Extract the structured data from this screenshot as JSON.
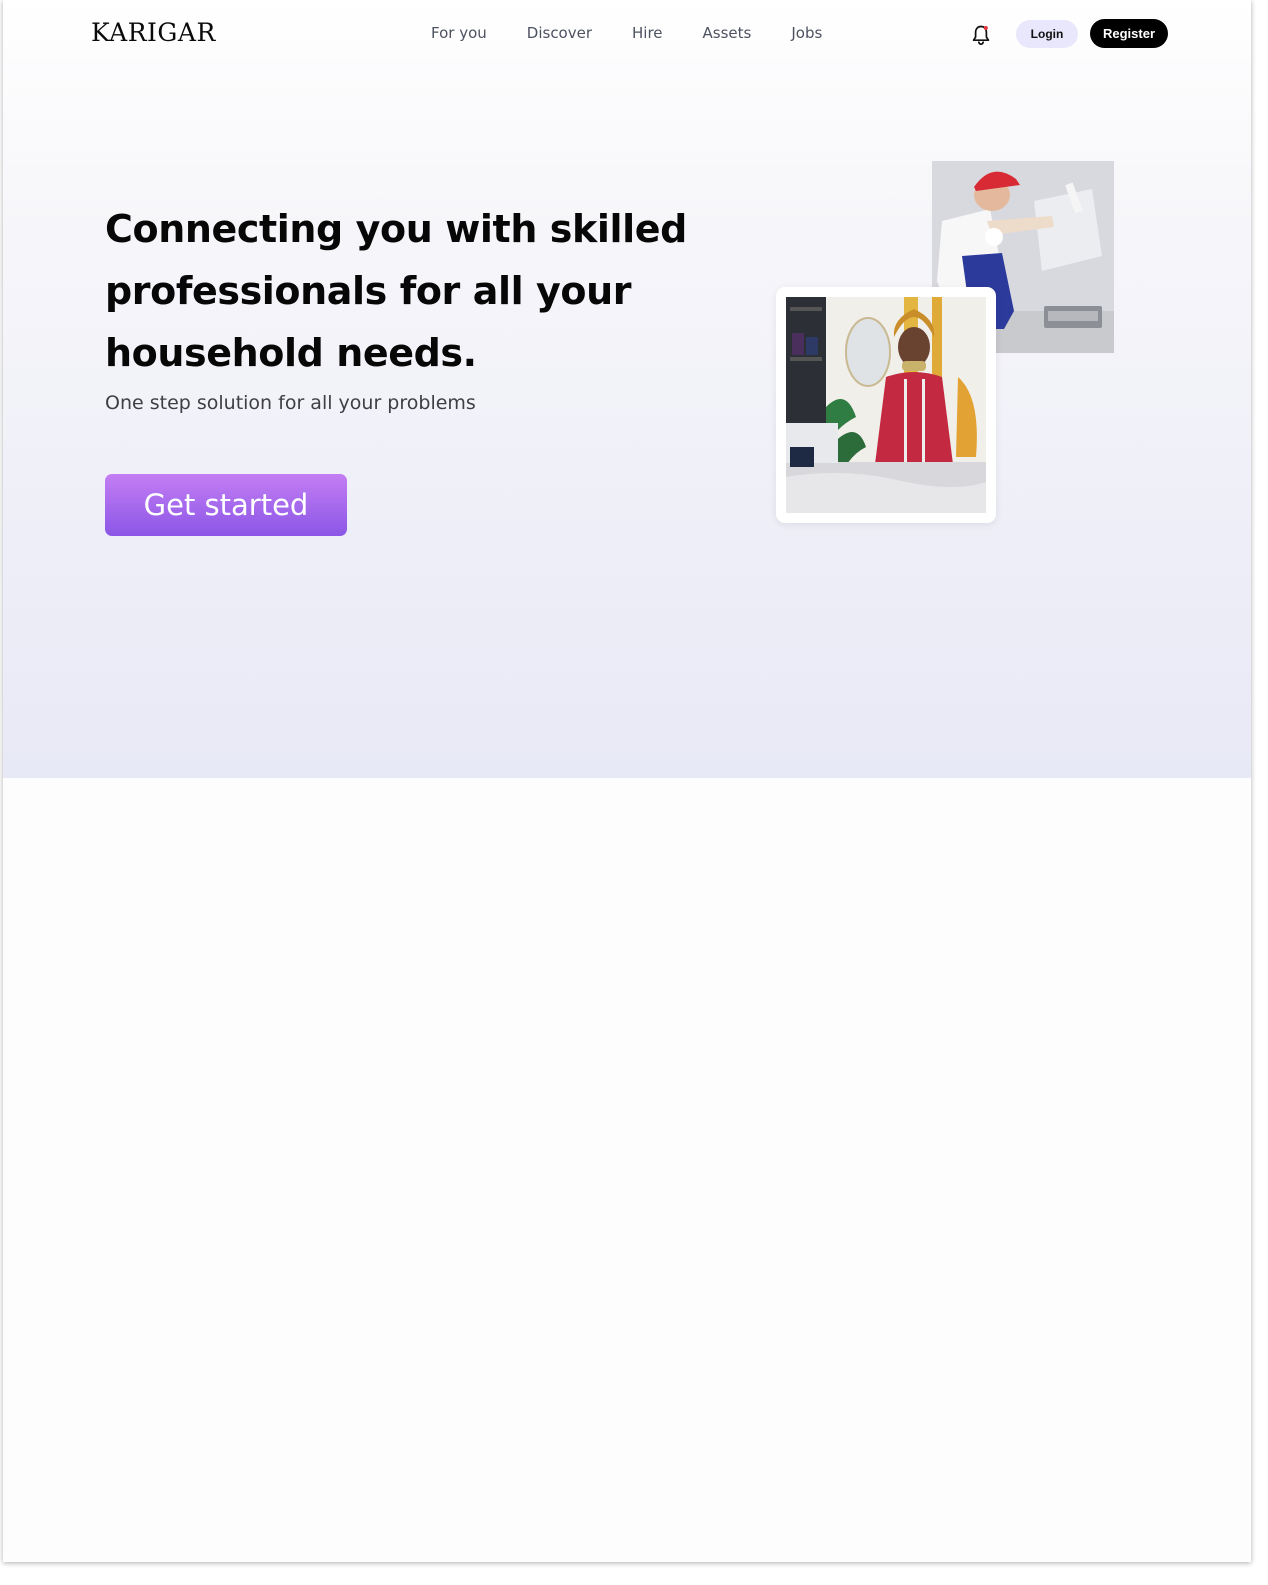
{
  "header": {
    "logo": "KARIGAR",
    "nav": [
      "For you",
      "Discover",
      "Hire",
      "Assets",
      "Jobs"
    ],
    "notification_icon": "bell-icon",
    "login_label": "Login",
    "register_label": "Register"
  },
  "hero": {
    "headline": "Connecting you with skilled professionals for all your household needs.",
    "subline": "One step solution for all your problems",
    "cta_label": "Get started",
    "images": [
      "painter-photo",
      "tailor-photo"
    ]
  },
  "colors": {
    "cta_gradient_top": "#c47ef4",
    "cta_gradient_bottom": "#8b56e6",
    "register_bg": "#000000",
    "login_bg": "#e9e7fb",
    "hero_bg": "#e8e9f6"
  }
}
